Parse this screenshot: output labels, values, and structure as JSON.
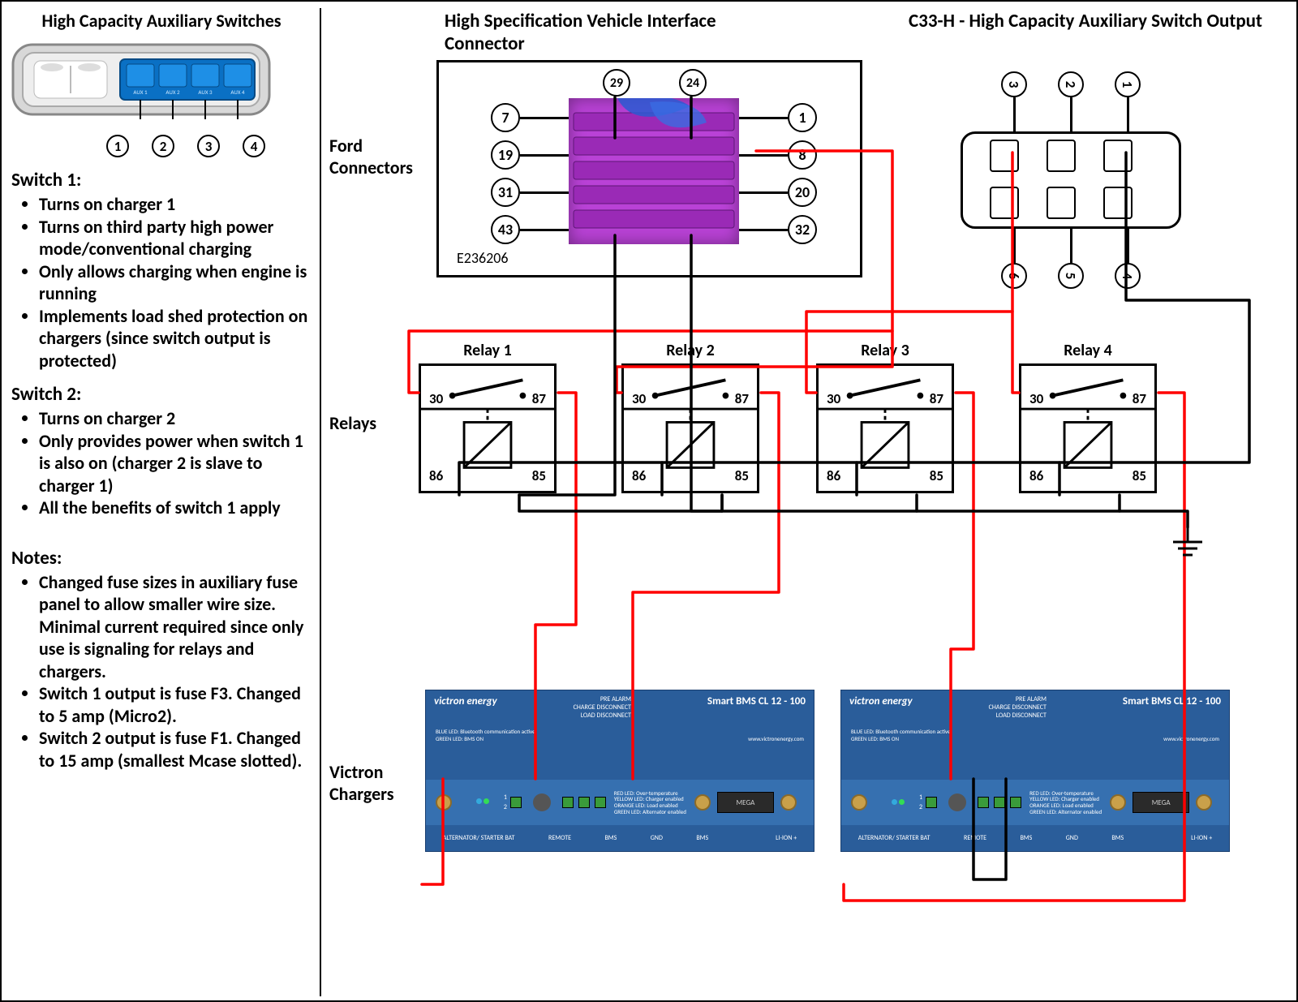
{
  "left": {
    "title": "High Capacity Auxiliary Switches",
    "switch_pins": [
      "1",
      "2",
      "3",
      "4"
    ],
    "switch_labels": [
      "AUX 1",
      "AUX 2",
      "AUX 3",
      "AUX 4"
    ],
    "sw1_heading": "Switch 1:",
    "sw1_items": [
      "Turns on charger 1",
      "Turns on third party high power mode/conventional charging",
      "Only allows charging when engine is running",
      "Implements load shed protection on chargers (since switch output is protected)"
    ],
    "sw2_heading": "Switch 2:",
    "sw2_items": [
      "Turns on charger 2",
      "Only provides power when switch 1 is also on (charger 2 is slave to charger 1)",
      "All the benefits of switch 1 apply"
    ],
    "notes_heading": "Notes:",
    "notes_items": [
      "Changed fuse sizes in auxiliary fuse panel to allow smaller wire size. Minimal current required since only use is signaling for relays and chargers.",
      "Switch 1 output is fuse F3. Changed to 5 amp (Micro2).",
      "Switch 2 output is fuse F1. Changed to 15 amp (smallest Mcase slotted)."
    ]
  },
  "row_labels": {
    "ford": "Ford Connectors",
    "relays": "Relays",
    "victron": "Victron Chargers"
  },
  "interface_conn": {
    "title": "High Specification Vehicle Interface Connector",
    "part_no": "E236206",
    "left_pins": [
      "7",
      "19",
      "31",
      "43"
    ],
    "right_pins": [
      "1",
      "8",
      "20",
      "32"
    ],
    "top_pins": [
      "29",
      "24"
    ]
  },
  "c33h": {
    "title": "C33-H - High Capacity Auxiliary Switch Output",
    "top_pins": [
      "3",
      "2",
      "1"
    ],
    "bottom_pins": [
      "6",
      "5",
      "4"
    ]
  },
  "relays": [
    {
      "name": "Relay 1",
      "t30": "30",
      "t87": "87",
      "t86": "86",
      "t85": "85"
    },
    {
      "name": "Relay 2",
      "t30": "30",
      "t87": "87",
      "t86": "86",
      "t85": "85"
    },
    {
      "name": "Relay 3",
      "t30": "30",
      "t87": "87",
      "t86": "86",
      "t85": "85"
    },
    {
      "name": "Relay 4",
      "t30": "30",
      "t87": "87",
      "t86": "86",
      "t85": "85"
    }
  ],
  "victron": {
    "brand": "victron energy",
    "model": "Smart BMS CL 12 - 100",
    "leds_top": [
      "PRE ALARM",
      "CHARGE DISCONNECT",
      "LOAD DISCONNECT"
    ],
    "leds_mid": [
      "BLUE LED:  Bluetooth communication active",
      "GREEN LED:  BMS ON"
    ],
    "leds_right": [
      "RED LED:  Over-temperature",
      "YELLOW LED:  Charger enabled",
      "ORANGE LED:  Load enabled",
      "GREEN LED:  Alternator enabled"
    ],
    "remote_nums": [
      "1",
      "2"
    ],
    "fuse_lbl": "MEGA",
    "footer": [
      "ALTERNATOR/ STARTER BAT",
      "REMOTE",
      "BMS",
      "GND",
      "BMS",
      "",
      "LI-ION +"
    ],
    "url": "www.victronenergy.com"
  }
}
